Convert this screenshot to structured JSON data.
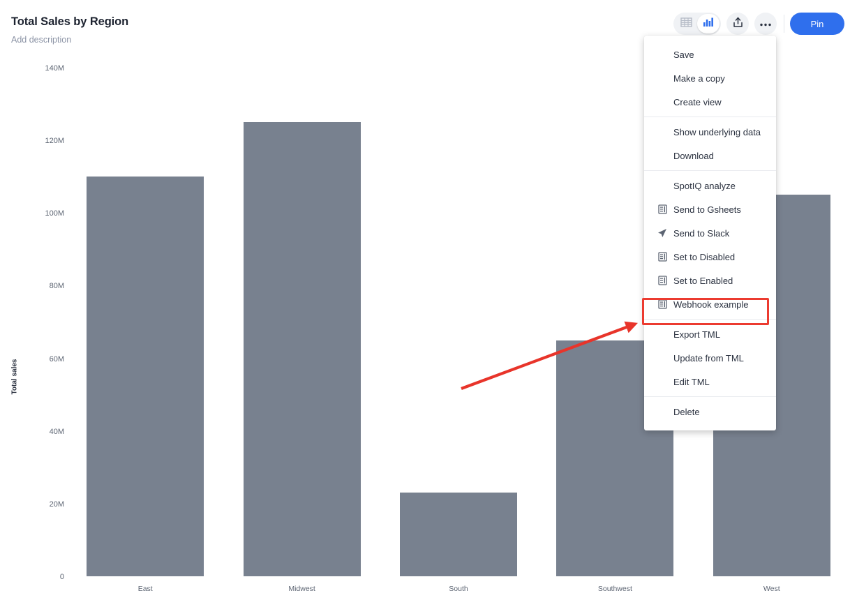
{
  "header": {
    "title": "Total Sales by Region",
    "description": "Add description",
    "toolbar": {
      "table_view_icon": "table-icon",
      "chart_view_icon": "bar-chart-icon",
      "share_icon": "share-icon",
      "more_icon": "more-options-icon",
      "pin_label": "Pin"
    }
  },
  "chart_data": {
    "type": "bar",
    "title": "Total Sales by Region",
    "categories": [
      "East",
      "Midwest",
      "South",
      "Southwest",
      "West"
    ],
    "values": [
      110000000,
      125000000,
      23000000,
      65000000,
      105000000
    ],
    "value_labels": [
      "110M",
      "125M",
      "23M",
      "65M",
      "105M"
    ],
    "xlabel": "",
    "ylabel": "Total sales",
    "ylim": [
      0,
      140000000
    ],
    "yticks": [
      0,
      20000000,
      40000000,
      60000000,
      80000000,
      100000000,
      120000000,
      140000000
    ],
    "ytick_labels": [
      "0",
      "20M",
      "40M",
      "60M",
      "80M",
      "100M",
      "120M",
      "140M"
    ],
    "grid": false,
    "legend": false,
    "series_color": "#78818f"
  },
  "menu": {
    "sections": [
      {
        "items": [
          {
            "label": "Save",
            "icon": null
          },
          {
            "label": "Make a copy",
            "icon": null
          },
          {
            "label": "Create view",
            "icon": null
          }
        ]
      },
      {
        "items": [
          {
            "label": "Show underlying data",
            "icon": null
          },
          {
            "label": "Download",
            "icon": null
          }
        ]
      },
      {
        "items": [
          {
            "label": "SpotIQ analyze",
            "icon": null
          },
          {
            "label": "Send to Gsheets",
            "icon": "document-icon"
          },
          {
            "label": "Send to Slack",
            "icon": "send-icon"
          },
          {
            "label": "Set to Disabled",
            "icon": "document-icon"
          },
          {
            "label": "Set to Enabled",
            "icon": "document-icon"
          },
          {
            "label": "Webhook example",
            "icon": "document-icon"
          }
        ]
      },
      {
        "items": [
          {
            "label": "Export TML",
            "icon": null
          },
          {
            "label": "Update from TML",
            "icon": null
          },
          {
            "label": "Edit TML",
            "icon": null
          }
        ]
      },
      {
        "items": [
          {
            "label": "Delete",
            "icon": null
          }
        ]
      }
    ]
  },
  "annotation": {
    "highlight_target": "Webhook example",
    "highlight_color": "#ec3b30",
    "arrow_color": "#e8342a"
  },
  "colors": {
    "accent": "#2f6fed",
    "bar": "#78818f",
    "text": "#2b3240",
    "muted": "#8b93a5"
  }
}
